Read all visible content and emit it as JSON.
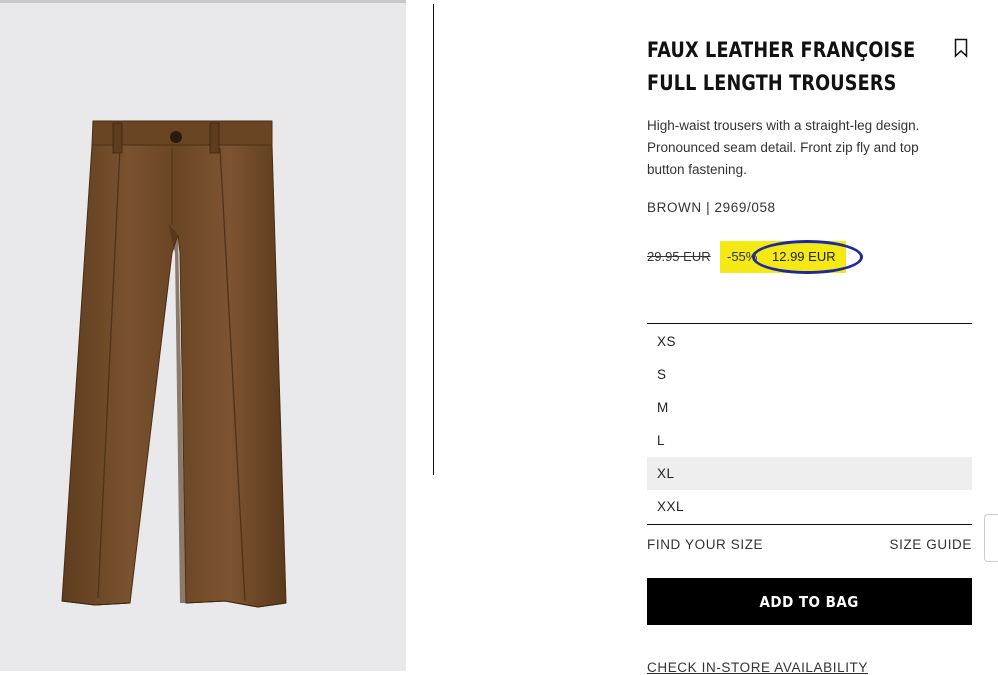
{
  "product": {
    "title_line1": "FAUX LEATHER FRANÇOISE",
    "title_line2": "FULL LENGTH TROUSERS",
    "description": "High-waist trousers with a straight-leg design. Pronounced seam detail. Front zip fly and top button fastening.",
    "color_ref": "BROWN | 2969/058",
    "image_icon": "brown-faux-leather-trousers",
    "bookmark_icon": "bookmark-icon"
  },
  "price": {
    "old": "29.95 EUR",
    "discount": "-55%",
    "new": "12.99 EUR",
    "highlight_color": "#f4e815",
    "annotation_color": "#1c2a9e"
  },
  "sizes": [
    {
      "label": "XS",
      "selected": false
    },
    {
      "label": "S",
      "selected": false
    },
    {
      "label": "M",
      "selected": false
    },
    {
      "label": "L",
      "selected": false
    },
    {
      "label": "XL",
      "selected": true
    },
    {
      "label": "XXL",
      "selected": false
    }
  ],
  "links": {
    "find_size": "FIND YOUR SIZE",
    "size_guide": "SIZE GUIDE",
    "check_store": "CHECK IN-STORE AVAILABILITY"
  },
  "actions": {
    "add_to_bag": "ADD TO BAG"
  }
}
